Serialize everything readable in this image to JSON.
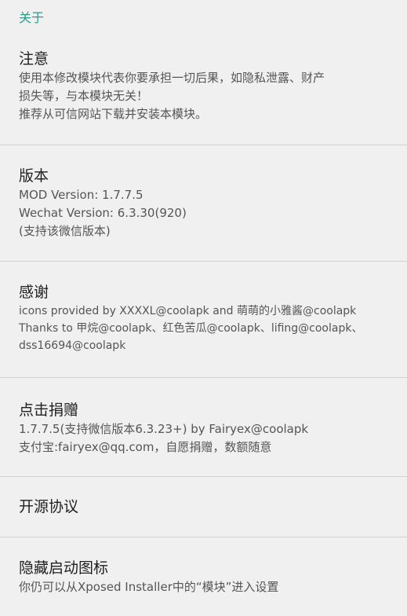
{
  "header": {
    "category_label": "关于"
  },
  "prefs": {
    "notice": {
      "title": "注意",
      "summary": "使用本修改模块代表你要承担一切后果，如隐私泄露、财产\n损失等，与本模块无关！\n推荐从可信网站下载并安装本模块。"
    },
    "version": {
      "title": "版本",
      "summary": "MOD Version: 1.7.7.5\nWechat Version: 6.3.30(920)\n(支持该微信版本)"
    },
    "thanks": {
      "title": "感谢",
      "summary": "icons provided by XXXXL@coolapk and 萌萌的小雅酱@coolapk\nThanks to 甲烷@coolapk、红色苦瓜@coolapk、lifing@coolapk、\ndss16694@coolapk"
    },
    "donate": {
      "title": "点击捐赠",
      "summary": "1.7.7.5(支持微信版本6.3.23+) by Fairyex@coolapk\n支付宝:fairyex@qq.com，自愿捐赠，数额随意"
    },
    "license": {
      "title": "开源协议"
    },
    "hide_icon": {
      "title": "隐藏启动图标",
      "summary": "你仍可以从Xposed Installer中的“模块”进入设置"
    }
  }
}
